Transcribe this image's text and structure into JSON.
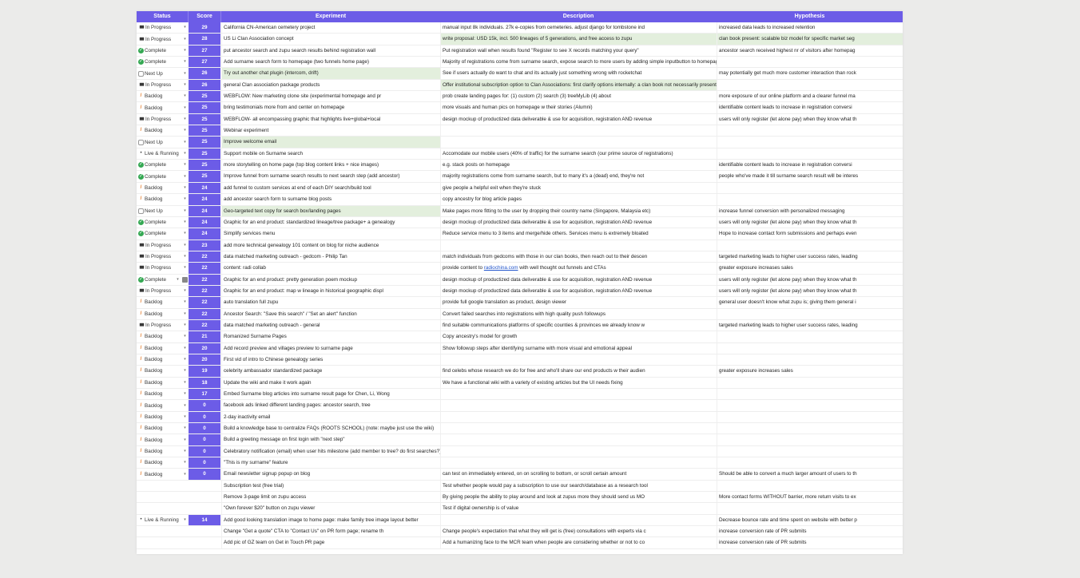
{
  "columns": {
    "status": "Status",
    "score": "Score",
    "experiment": "Experiment",
    "description": "Description",
    "hypothesis": "Hypothesis"
  },
  "colors": {
    "header": "#6c5ce7",
    "score_cell": "#6c5ce7",
    "highlight": "#e3efdd",
    "complete": "#35a853",
    "backlog": "#e3731c"
  },
  "rows": [
    {
      "icon": "progress",
      "status": "In Progress",
      "score": "29",
      "experiment": "California CN-American cemetery project",
      "description": "manual input 8k individuals. 27k e-copies from cemeteries. adjust django for tombstone ind",
      "hypothesis": "increased data leads to increased retention",
      "hl": ""
    },
    {
      "icon": "progress",
      "status": "In Progress",
      "score": "28",
      "experiment": "US Li Clan Association concept",
      "description": "write proposal: USD 15k, incl. 500 lineages of 5 generations, and free access to zupu",
      "hypothesis": "clan book present: scalable biz model for specific market seg",
      "hl": "desc hyp"
    },
    {
      "icon": "done",
      "status": "Complete",
      "score": "27",
      "experiment": "put ancestor search and zupu search results behind registration wall",
      "description": "Put registration wall when results found \"Register to see X records matching your query\"",
      "hypothesis": "ancestor search received highest nr of visitors after homepag",
      "hl": ""
    },
    {
      "icon": "done",
      "status": "Complete",
      "score": "27",
      "experiment": "Add surname search form to homepage (two funnels home page)",
      "description": "Majority of registrations come from surname search, expose search to more users by adding simple inputbutton to homepage",
      "hypothesis": "",
      "hl": ""
    },
    {
      "icon": "next",
      "status": "Next Up",
      "score": "26",
      "experiment": "Try out another chat plugin (intercom, drift)",
      "description": "See if users actually do want to chat and its actually just something wrong with rocketchat",
      "hypothesis": "may potentially get much more customer interaction than rock",
      "hl": "exp"
    },
    {
      "icon": "progress",
      "status": "In Progress",
      "score": "26",
      "experiment": "general Clan association package products",
      "description": "Offer institutional subscription option to Clan Associations: first clarify options internally: a clan book not necessarily present: scalable biz model for spe",
      "hypothesis": "",
      "hl": "desc"
    },
    {
      "icon": "backlog",
      "status": "Backlog",
      "score": "25",
      "experiment": "WEBFLOW: New marketing clone site (experimental homepage and pr",
      "description": "prob create landing pages for: (1) custom (2) search (3) treeMyLib (4) about",
      "hypothesis": "more exposure of our online platform and a clearer funnel ma",
      "hl": ""
    },
    {
      "icon": "backlog",
      "status": "Backlog",
      "score": "25",
      "experiment": "bring testimonials more from and center on homepage",
      "description": "more visuals and human pics on homepage w their stories (Alumni)",
      "hypothesis": "identifiable content leads to increase in registration conversi",
      "hl": ""
    },
    {
      "icon": "progress",
      "status": "In Progress",
      "score": "25",
      "experiment": "WEBFLOW- all encompassing graphic that highlights live+global+local",
      "description": "design mockup of productized data deliverable & use for acquisition, registration AND revenue",
      "hypothesis": "users will only register (let alone pay) when they know what th",
      "hl": ""
    },
    {
      "icon": "backlog",
      "status": "Backlog",
      "score": "25",
      "experiment": "Webinar experiment",
      "description": "",
      "hypothesis": "",
      "hl": ""
    },
    {
      "icon": "next",
      "status": "Next Up",
      "score": "25",
      "experiment": "Improve welcome email",
      "description": "",
      "hypothesis": "",
      "hl": "exp"
    },
    {
      "icon": "live",
      "status": "Live & Running",
      "score": "25",
      "experiment": "Support mobile on Surname search",
      "description": "Accomodate our mobile users (40% of traffic) for the surname search (our prime source of registrations)",
      "hypothesis": "",
      "hl": ""
    },
    {
      "icon": "done",
      "status": "Complete",
      "score": "25",
      "experiment": "more storytelling on home page (top blog content links + nice images)",
      "description": "e.g. stack posts on homepage",
      "hypothesis": "identifiable content leads to increase in registration conversi",
      "hl": ""
    },
    {
      "icon": "done",
      "status": "Complete",
      "score": "25",
      "experiment": "Improve funnel from surname search results to next search step (add ancestor)",
      "description": "majority registrations come from surname search, but to many it's a (dead) end, they're not",
      "hypothesis": "people who've made it till surname search result will be interes",
      "hl": ""
    },
    {
      "icon": "backlog",
      "status": "Backlog",
      "score": "24",
      "experiment": "add funnel to custom services at end of each DIY search/build tool",
      "description": "give people a helpful exit when they're stuck",
      "hypothesis": "",
      "hl": ""
    },
    {
      "icon": "backlog",
      "status": "Backlog",
      "score": "24",
      "experiment": "add ancestor search form to surname blog posts",
      "description": "copy ancestry for blog article pages",
      "hypothesis": "",
      "hl": ""
    },
    {
      "icon": "next",
      "status": "Next Up",
      "score": "24",
      "experiment": "Geo-targeted text copy for search box/landing pages",
      "description": "Make pages more fitting to the user by dropping their country name (Singapore, Malaysia etc)",
      "hypothesis": "increase funnel conversion with personalized messaging",
      "hl": "exp"
    },
    {
      "icon": "done",
      "status": "Complete",
      "score": "24",
      "experiment": "Graphic for an end product: standardized lineage/tree package+ a genealogy",
      "description": "design mockup of productized data deliverable & use for acquisition, registration AND revenue",
      "hypothesis": "users will only register (let alone pay) when they know what th",
      "hl": ""
    },
    {
      "icon": "done",
      "status": "Complete",
      "score": "24",
      "experiment": "Simplify services menu",
      "description": "Reduce service menu to 3 items and merge/hide others. Services menu is extremely bloated",
      "hypothesis": "Hope to increase contact form submissions and perhaps even",
      "hl": ""
    },
    {
      "icon": "progress",
      "status": "In Progress",
      "score": "23",
      "experiment": "add more technical genealogy 101 content on blog for niche audience",
      "description": "",
      "hypothesis": "",
      "hl": ""
    },
    {
      "icon": "progress",
      "status": "In Progress",
      "score": "22",
      "experiment": "data matched marketing outreach - gedcom - Philip Tan",
      "description": "match individuals from gedcoms with those in our clan books, then reach out to their descen",
      "hypothesis": "targeted marketing leads to higher user success rates, leading",
      "hl": ""
    },
    {
      "icon": "progress",
      "status": "In Progress",
      "score": "22",
      "experiment": "content: radi collab",
      "description": "provide content to radiochina.com with well thought out funnels and CTAs",
      "hypothesis": "greater exposure increases sales",
      "hl": "",
      "link": true
    },
    {
      "icon": "done",
      "status": "Complete",
      "score": "22",
      "experiment": "Graphic for an end product: pretty generation poem mockup",
      "description": "design mockup of productized data deliverable & use for acquisition, registration AND revenue",
      "hypothesis": "users will only register (let alone pay) when they know what th",
      "hl": "",
      "badge": true
    },
    {
      "icon": "progress",
      "status": "In Progress",
      "score": "22",
      "experiment": "Graphic for an end product: map w lineage in historical geographic displ",
      "description": "design mockup of productized data deliverable & use for acquisition, registration AND revenue",
      "hypothesis": "users will only register (let alone pay) when they know what th",
      "hl": ""
    },
    {
      "icon": "backlog",
      "status": "Backlog",
      "score": "22",
      "experiment": "auto translation full zupu",
      "description": "provide full google translation as product, design viewer",
      "hypothesis": "general user doesn't know what zupu is; giving them general i",
      "hl": ""
    },
    {
      "icon": "backlog",
      "status": "Backlog",
      "score": "22",
      "experiment": "Ancestor Search: \"Save this search\" / \"Set an alert\" function",
      "description": "Convert failed searches into registrations with high quality push followups",
      "hypothesis": "",
      "hl": ""
    },
    {
      "icon": "progress",
      "status": "In Progress",
      "score": "22",
      "experiment": "data matched marketing outreach - general",
      "description": "find suitable communications platforms of specific counties & provinces we already know w",
      "hypothesis": "targeted marketing leads to higher user success rates, leading",
      "hl": ""
    },
    {
      "icon": "backlog",
      "status": "Backlog",
      "score": "21",
      "experiment": "Romanized Surname Pages",
      "description": "Copy ancestry's model for growth",
      "hypothesis": "",
      "hl": ""
    },
    {
      "icon": "backlog",
      "status": "Backlog",
      "score": "20",
      "experiment": "Add record preview and villages preview to surname page",
      "description": "Show followup steps after identifying surname with more visual and emotional appeal",
      "hypothesis": "",
      "hl": ""
    },
    {
      "icon": "backlog",
      "status": "Backlog",
      "score": "20",
      "experiment": "First vid of intro to Chinese genealogy series",
      "description": "",
      "hypothesis": "",
      "hl": ""
    },
    {
      "icon": "backlog",
      "status": "Backlog",
      "score": "19",
      "experiment": "celebrity ambassador standardized package",
      "description": "find celebs whose research we do for free and who'll share our end products w their audien",
      "hypothesis": "greater exposure increases sales",
      "hl": ""
    },
    {
      "icon": "backlog",
      "status": "Backlog",
      "score": "18",
      "experiment": "Update the wiki and make it work again",
      "description": "We have a functional wiki with a variety of existing articles but the UI needs fixing",
      "hypothesis": "",
      "hl": ""
    },
    {
      "icon": "backlog",
      "status": "Backlog",
      "score": "17",
      "experiment": "Embed Surname blog articles into surname result page for Chen, Li, Wong",
      "description": "",
      "hypothesis": "",
      "hl": ""
    },
    {
      "icon": "backlog",
      "status": "Backlog",
      "score": "0",
      "experiment": "facebook ads linked different landing pages: ancestor search, tree",
      "description": "",
      "hypothesis": "",
      "hl": ""
    },
    {
      "icon": "backlog",
      "status": "Backlog",
      "score": "0",
      "experiment": "2-day inactivity email",
      "description": "",
      "hypothesis": "",
      "hl": ""
    },
    {
      "icon": "backlog",
      "status": "Backlog",
      "score": "0",
      "experiment": "Build a knowledge base to centralize FAQs (ROOTS SCHOOL) (note: maybe just use the wiki)",
      "description": "",
      "hypothesis": "",
      "hl": ""
    },
    {
      "icon": "backlog",
      "status": "Backlog",
      "score": "0",
      "experiment": "Build a greeting message on first login with \"next step\"",
      "description": "",
      "hypothesis": "",
      "hl": ""
    },
    {
      "icon": "backlog",
      "status": "Backlog",
      "score": "0",
      "experiment": "Celebratory notification (email) when user hits milestone (add member to tree? do first searches?)",
      "description": "",
      "hypothesis": "",
      "hl": ""
    },
    {
      "icon": "backlog",
      "status": "Backlog",
      "score": "0",
      "experiment": "\"This is my surname\" feature",
      "description": "",
      "hypothesis": "",
      "hl": ""
    },
    {
      "icon": "backlog",
      "status": "Backlog",
      "score": "0",
      "experiment": "Email newsletter signup popup on blog",
      "description": "can test on immediately entered, on on scrolling to bottom, or scroll certain amount",
      "hypothesis": "Should be able to convert a much larger amount of users to th",
      "hl": ""
    },
    {
      "icon": "",
      "status": "",
      "score": "",
      "experiment": "Subscription test (free trial)",
      "description": "Test whether people would pay a subscription to use our search/database as a research tool",
      "hypothesis": "",
      "hl": ""
    },
    {
      "icon": "",
      "status": "",
      "score": "",
      "experiment": "Remove 3-page limit on zupu access",
      "description": "By giving people the ability to play around and look at zupus more they should send us MO",
      "hypothesis": "More contact forms WITHOUT barrier, more return visits to ex",
      "hl": ""
    },
    {
      "icon": "",
      "status": "",
      "score": "",
      "experiment": "\"Own forever $20\" button on zupu viewer",
      "description": "Test if digital ownership is of value",
      "hypothesis": "",
      "hl": ""
    },
    {
      "icon": "live",
      "status": "Live & Running",
      "score": "14",
      "experiment": "Add good looking translation image to home page: make family tree image layout better",
      "description": "",
      "hypothesis": "Decrease bounce rate and time spent on website with better p",
      "hl": ""
    },
    {
      "icon": "",
      "status": "",
      "score": "",
      "experiment": "Change \"Get a quote\" CTA to \"Contact Us\" on PR form page; rename th",
      "description": "Change people's expectation that what they will get is (free) consultations with experts via c",
      "hypothesis": "increase conversion rate of PR submits",
      "hl": ""
    },
    {
      "icon": "",
      "status": "",
      "score": "",
      "experiment": "Add pic of GZ team on Get in Touch PR page",
      "description": "Add a humanizing face to the MCR team when people are considering whether or not to co",
      "hypothesis": "increase conversion rate of PR submits",
      "hl": ""
    }
  ]
}
